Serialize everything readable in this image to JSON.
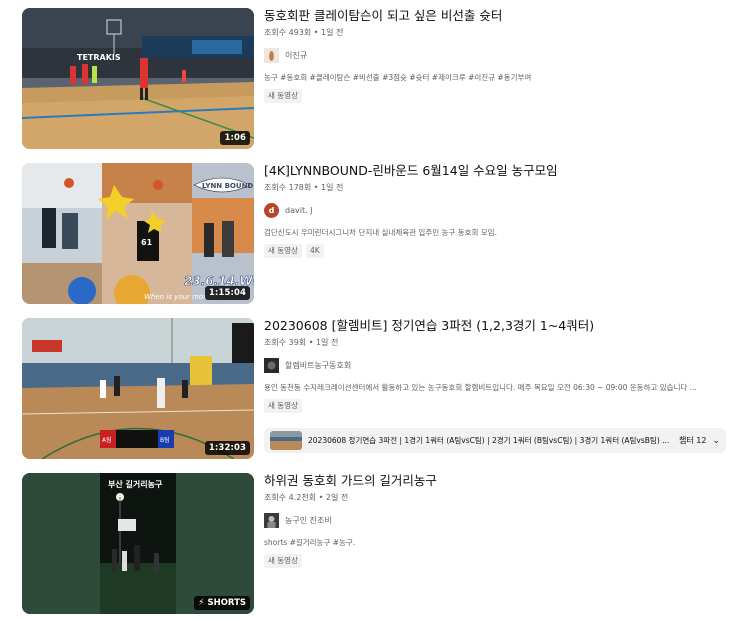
{
  "results": [
    {
      "title": "동호회판 클레이탐슨이 되고 싶은 비선출 슛터",
      "meta": "조회수 493회 • 1일 전",
      "channel": "이진규",
      "description": "농구 #동호회 #클레이탐슨 #비선출 #3점슛 #슛터 #제이크루 #이진규 #동기부여",
      "badges": [
        "새 동영상"
      ],
      "duration": "1:06",
      "thumb_text": "TETRAKIS"
    },
    {
      "title": "[4K]LYNNBOUND-린바운드 6월14일 수요일 농구모임",
      "meta": "조회수 178회 • 1일 전",
      "channel": "davit. J",
      "avatar_letter": "d",
      "description": "검단신도시 우미린더시그니처 단지내 실내체육관 입주민 농구 동호회 모임.",
      "badges": [
        "새 동영상",
        "4K"
      ],
      "duration": "1:15:04",
      "thumb_text": "23.6.14.WED",
      "thumb_subtext": "When is your moment",
      "thumb_logo": "LYNN BOUND",
      "thumb_jersey": "61"
    },
    {
      "title": "20230608 [할렘비트] 정기연습 3파전 (1,2,3경기 1~4쿼터)",
      "meta": "조회수 39회 • 1일 전",
      "channel": "할렘비트농구동호회",
      "description": "용인 동천동 수지레크레이션센터에서 활동하고 있는 농구동호회 할렘비트입니다. 매주 목요일 오전 06:30 ~ 09:00 운동하고 있습니다 ...",
      "badges": [
        "새 동영상"
      ],
      "duration": "1:32:03",
      "chapters_text": "20230608 정기연습 3파전 | 1경기 1쿼터 (A팀vsC팀) | 2경기 1쿼터 (B팀vsC팀) | 3경기 1쿼터 (A팀vsB팀) ...",
      "chapters_count": "챕터 12",
      "score_left": "A팀",
      "score_right": "B팀"
    },
    {
      "title": "하위권 동호회 가드의 길거리농구",
      "meta": "조회수 4.2천회 • 2일 전",
      "channel": "농구인 진조비",
      "description": "shorts #길거리농구 #농구.",
      "badges": [
        "새 동영상"
      ],
      "shorts_label": "SHORTS",
      "thumb_text": "부산 길거리농구"
    }
  ],
  "colors": {
    "text_primary": "#0f0f0f",
    "text_secondary": "#606060",
    "badge_bg": "#f2f2f2",
    "shorts_bg": "#2e4a3a"
  }
}
